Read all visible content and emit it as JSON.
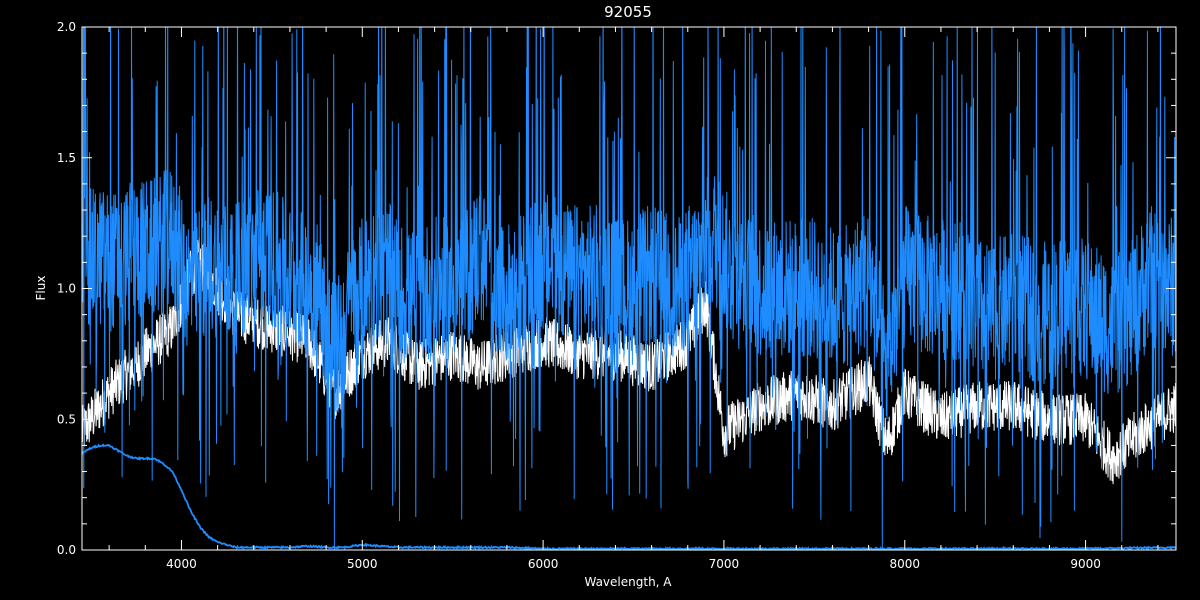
{
  "chart_data": {
    "type": "line",
    "title": "92055",
    "xlabel": "Wavelength, A",
    "ylabel": "Flux",
    "xlim": [
      3450,
      9500
    ],
    "ylim": [
      0,
      2
    ],
    "xticks": [
      {
        "value": 4000,
        "label": "4000"
      },
      {
        "value": 5000,
        "label": "5000"
      },
      {
        "value": 6000,
        "label": "6000"
      },
      {
        "value": 7000,
        "label": "7000"
      },
      {
        "value": 8000,
        "label": "8000"
      },
      {
        "value": 9000,
        "label": "9000"
      }
    ],
    "yticks": [
      {
        "value": 0,
        "label": "0.0"
      },
      {
        "value": 0.5,
        "label": "0.5"
      },
      {
        "value": 1.0,
        "label": "1.0"
      },
      {
        "value": 1.5,
        "label": "1.5"
      },
      {
        "value": 2.0,
        "label": "2.0"
      }
    ],
    "colors": {
      "background": "#000000",
      "axes": "#ffffff",
      "primary": "#1e8cff",
      "secondary": "#ffffff"
    },
    "series": [
      {
        "color": "#ffffff",
        "style": "lower-envelope",
        "x": [
          3450,
          3600,
          3800,
          3950,
          4050,
          4100,
          4300,
          4500,
          4700,
          4850,
          5000,
          5150,
          5300,
          5500,
          5650,
          5800,
          6000,
          6200,
          6400,
          6600,
          6800,
          6900,
          7000,
          7200,
          7400,
          7600,
          7800,
          7900,
          8000,
          8200,
          8400,
          8600,
          8800,
          9000,
          9150,
          9300,
          9500
        ],
        "y": [
          0.45,
          0.6,
          0.75,
          0.85,
          1.05,
          1.1,
          0.9,
          0.85,
          0.8,
          0.6,
          0.75,
          0.8,
          0.7,
          0.75,
          0.7,
          0.75,
          0.8,
          0.75,
          0.75,
          0.7,
          0.8,
          0.95,
          0.45,
          0.55,
          0.6,
          0.55,
          0.65,
          0.4,
          0.6,
          0.5,
          0.55,
          0.55,
          0.5,
          0.5,
          0.35,
          0.45,
          0.55
        ]
      },
      {
        "color": "#1e8cff",
        "style": "spectrum",
        "x": [
          3450,
          3550,
          3650,
          3750,
          3850,
          3950,
          4050,
          4150,
          4300,
          4450,
          4600,
          4750,
          4850,
          4950,
          5050,
          5150,
          5250,
          5400,
          5550,
          5650,
          5750,
          5850,
          6000,
          6150,
          6300,
          6450,
          6600,
          6750,
          6850,
          6950,
          7050,
          7200,
          7350,
          7500,
          7650,
          7800,
          7900,
          8000,
          8150,
          8300,
          8450,
          8600,
          8750,
          8900,
          9050,
          9150,
          9250,
          9350,
          9500
        ],
        "y": [
          1.1,
          1.12,
          1.1,
          1.15,
          1.15,
          1.2,
          1.0,
          1.1,
          1.05,
          1.15,
          1.05,
          1.0,
          0.75,
          0.95,
          1.05,
          1.05,
          0.95,
          1.0,
          1.0,
          1.15,
          0.95,
          1.0,
          1.1,
          1.05,
          1.05,
          1.0,
          1.05,
          1.0,
          1.1,
          1.2,
          1.05,
          1.0,
          1.0,
          1.0,
          0.95,
          1.05,
          0.7,
          1.05,
          1.0,
          1.0,
          0.9,
          0.95,
          0.9,
          0.95,
          0.9,
          0.85,
          0.9,
          1.05,
          1.0
        ]
      },
      {
        "color": "#1e8cff",
        "style": "continuum",
        "x": [
          3450,
          3500,
          3550,
          3600,
          3650,
          3700,
          3750,
          3800,
          3850,
          3900,
          3950,
          4000,
          4050,
          4100,
          4150,
          4200,
          4250,
          4300,
          4400,
          4500,
          4600,
          4700,
          4800,
          4900,
          5000,
          5100,
          5200,
          5400,
          5600,
          5800,
          6000,
          6500,
          7000,
          7500,
          8000,
          8500,
          9000,
          9500
        ],
        "y": [
          0.37,
          0.39,
          0.4,
          0.4,
          0.38,
          0.36,
          0.35,
          0.35,
          0.35,
          0.33,
          0.3,
          0.23,
          0.15,
          0.09,
          0.05,
          0.03,
          0.02,
          0.01,
          0.01,
          0.01,
          0.01,
          0.015,
          0.01,
          0.01,
          0.02,
          0.015,
          0.01,
          0.01,
          0.01,
          0.01,
          0.005,
          0.005,
          0.005,
          0.005,
          0.005,
          0.005,
          0.005,
          0.01
        ]
      }
    ]
  }
}
